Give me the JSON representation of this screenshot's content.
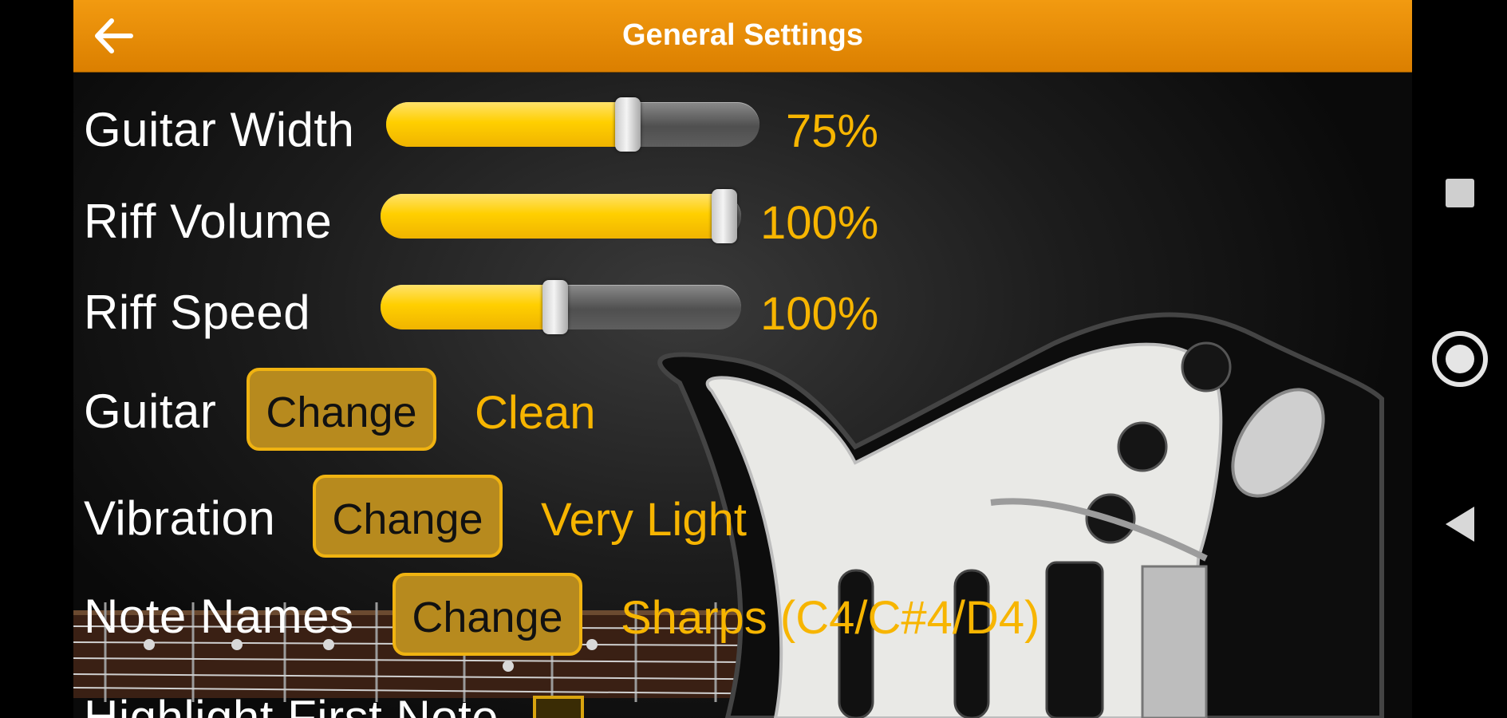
{
  "header": {
    "title": "General Settings",
    "back_icon": "arrow-left-icon"
  },
  "settings": {
    "guitar_width": {
      "label": "Guitar Width",
      "value": "75%",
      "level": 0.75
    },
    "riff_volume": {
      "label": "Riff Volume",
      "value": "100%",
      "level": 1.0
    },
    "riff_speed": {
      "label": "Riff Speed",
      "value": "100%",
      "level": 0.5
    },
    "guitar": {
      "label": "Guitar",
      "button": "Change",
      "value": "Clean"
    },
    "vibration": {
      "label": "Vibration",
      "button": "Change",
      "value": "Very Light"
    },
    "note_names": {
      "label": "Note Names",
      "button": "Change",
      "value": "Sharps (C4/C#4/D4)"
    },
    "highlight_first_note": {
      "label": "Highlight First Note"
    }
  },
  "colors": {
    "accent": "#f7b500",
    "header": "#e88c00"
  },
  "navbar": {
    "icons": [
      "square-icon",
      "circle-icon",
      "triangle-back-icon"
    ]
  }
}
